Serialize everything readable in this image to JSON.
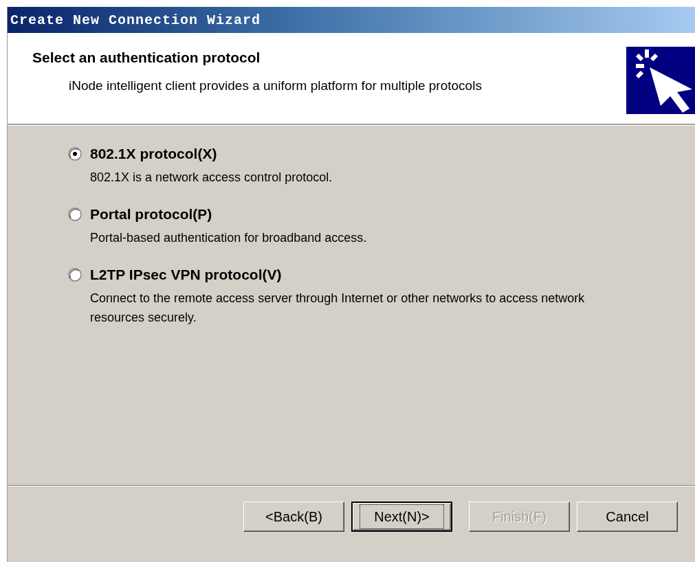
{
  "window": {
    "title": "Create New Connection Wizard"
  },
  "header": {
    "title": "Select an authentication protocol",
    "subtitle": "iNode intelligent client provides a uniform platform for multiple protocols"
  },
  "options": [
    {
      "label": "802.1X protocol(X)",
      "description": "802.1X is a network access control protocol.",
      "selected": true
    },
    {
      "label": "Portal protocol(P)",
      "description": "Portal-based authentication for broadband access.",
      "selected": false
    },
    {
      "label": "L2TP IPsec VPN protocol(V)",
      "description": "Connect to the remote access server through Internet or other networks to access network resources securely.",
      "selected": false
    }
  ],
  "buttons": [
    {
      "label": "<Back(B)",
      "default": false,
      "disabled": false
    },
    {
      "label": "Next(N)>",
      "default": true,
      "disabled": false
    },
    {
      "label": "Finish(F)",
      "default": false,
      "disabled": true
    },
    {
      "label": "Cancel",
      "default": false,
      "disabled": false
    }
  ]
}
